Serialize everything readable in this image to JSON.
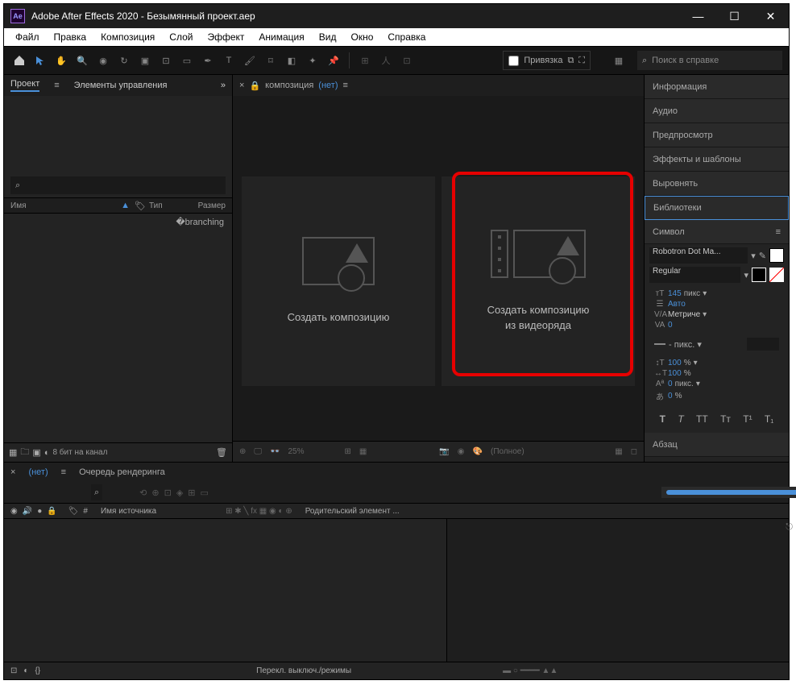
{
  "titlebar": {
    "app": "Ae",
    "title": "Adobe After Effects 2020 - Безымянный проект.aep"
  },
  "menu": {
    "file": "Файл",
    "edit": "Правка",
    "composition": "Композиция",
    "layer": "Слой",
    "effect": "Эффект",
    "animation": "Анимация",
    "view": "Вид",
    "window": "Окно",
    "help": "Справка"
  },
  "toolbar": {
    "snap": "Привязка",
    "search_placeholder": "Поиск в справке"
  },
  "project_panel": {
    "tab_project": "Проект",
    "tab_controls": "Элементы управления",
    "more": "»",
    "search_icon": "⌕",
    "col_name": "Имя",
    "col_type": "Тип",
    "col_size": "Размер",
    "footer_bits": "8 бит на канал"
  },
  "composition_panel": {
    "tab_prefix": "композиция",
    "none": "(нет)",
    "create_comp": "Создать композицию",
    "create_from_footage_l1": "Создать композицию",
    "create_from_footage_l2": "из видеоряда",
    "footer_zoom": "25%",
    "footer_quality": "(Полное)"
  },
  "right_panels": {
    "info": "Информация",
    "audio": "Аудио",
    "preview": "Предпросмотр",
    "effects": "Эффекты и шаблоны",
    "align": "Выровнять",
    "libraries": "Библиотеки",
    "character": "Символ",
    "paragraph": "Абзац"
  },
  "character": {
    "font": "Robotron Dot Ma...",
    "style": "Regular",
    "size_val": "145",
    "size_unit": "пикс",
    "leading": "Авто",
    "kerning": "Метриче",
    "tracking": "0",
    "stroke_unit": "пикс.",
    "vscale": "100",
    "vscale_unit": "%",
    "hscale": "100",
    "hscale_unit": "%",
    "baseline": "0",
    "baseline_unit": "пикс.",
    "tsume": "0",
    "tsume_unit": "%",
    "faux": {
      "bold": "T",
      "italic": "T",
      "allcaps": "TT",
      "smallcaps": "Tт",
      "super": "T¹",
      "sub": "T₁"
    }
  },
  "timeline": {
    "tab_none": "(нет)",
    "tab_render": "Очередь рендеринга",
    "col_source": "Имя источника",
    "col_parent": "Родительский элемент ...",
    "footer_modes": "Перекл. выключ./режимы"
  }
}
